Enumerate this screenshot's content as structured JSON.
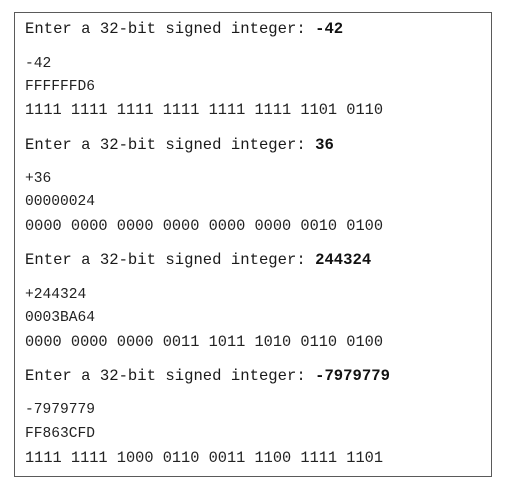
{
  "console": {
    "runs": [
      {
        "prompt": "Enter a 32-bit signed integer: ",
        "input": "-42",
        "decimal": "-42",
        "hex": "FFFFFFD6",
        "binary": "1111 1111 1111 1111 1111 1111 1101 0110"
      },
      {
        "prompt": "Enter a 32-bit signed integer: ",
        "input": "36",
        "decimal": "+36",
        "hex": "00000024",
        "binary": "0000 0000 0000 0000 0000 0000 0010 0100"
      },
      {
        "prompt": "Enter a 32-bit signed integer: ",
        "input": "244324",
        "decimal": "+244324",
        "hex": "0003BA64",
        "binary": "0000 0000 0000 0011 1011 1010 0110 0100"
      },
      {
        "prompt": "Enter a 32-bit signed integer: ",
        "input": "-7979779",
        "decimal": "-7979779",
        "hex": "FF863CFD",
        "binary": "1111 1111 1000 0110 0011 1100 1111 1101"
      }
    ]
  }
}
